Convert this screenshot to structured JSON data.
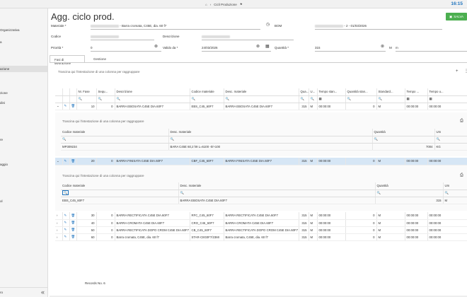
{
  "topbar": {
    "home_icon": "home-icon",
    "breadcrumb": "Cicli Produzione",
    "time": "16:15"
  },
  "sidebar": {
    "items": [
      "Organizzativa",
      "a",
      "azione",
      "zione",
      "dini",
      "re",
      "aggio",
      "ol"
    ],
    "footer_label": "ro",
    "collapse_glyph": "«"
  },
  "header": {
    "title": "Agg. ciclo prod.",
    "save_label": "SALVA"
  },
  "form": {
    "materiale_label": "Materiale *",
    "materiale_value": " - Barra cromata, C45E, dia. 60 f7",
    "bom_label": "BOM",
    "bom_value": " - 2 - 01/03/2026",
    "codice_label": "Codice",
    "descrizione_label": "Descrizione",
    "priorita_label": "Priorità *",
    "priorita_value": "0",
    "valido_label": "Valido da *",
    "valido_value": "24/03/2026",
    "quantita_label": "Quantità *",
    "quantita_value": "315",
    "um_label": "M",
    "um_value": "m"
  },
  "tabs": [
    "Fasi di lavorazione",
    "Gestione"
  ],
  "grid": {
    "group_hint": "Trascina qui l'intestazione di una colonna per raggruppare",
    "columns": [
      "Nr. Fase",
      "Sequ...",
      "Descrizione",
      "Codice materiale",
      "Desc. materiale",
      "Qua...",
      "U...",
      "Tempo stan...",
      "Quantità stan...",
      "Standard...",
      "Tempo ...",
      "Tempo u..."
    ],
    "rows": [
      {
        "fase": "10",
        "seq": "0",
        "desc": "BARRA EBOSATA C45E DIA.60F7",
        "code": "EBS_C45_60F7",
        "mat": "BARRA EBOSATA C45E DIA.60F7",
        "qty": "315",
        "um": "M",
        "t1": "00:00:00",
        "q2": "0",
        "um2": "M",
        "t2": "00:00:00",
        "t3": "00:00:00"
      },
      {
        "fase": "20",
        "seq": "0",
        "desc": "BARRA FINISATA C45E DIA.60F7",
        "code": "CBF_C45_60F7",
        "mat": "BARRA FINISATA C45E DIA.60F7",
        "qty": "315",
        "um": "M",
        "t1": "00:00:00",
        "q2": "0",
        "um2": "M",
        "t2": "00:00:00",
        "t3": "00:00:00"
      },
      {
        "fase": "30",
        "seq": "0",
        "desc": "BARRA RECTIFICATA C45E DIA.60F7",
        "code": "RFC_C45_60F7",
        "mat": "BARRA RECTIFICATA C45E DIA.60F7",
        "qty": "315",
        "um": "M",
        "t1": "00:00:00",
        "q2": "0",
        "um2": "M",
        "t2": "00:00:00",
        "t3": "00:00:00"
      },
      {
        "fase": "40",
        "seq": "0",
        "desc": "BARRA CROMATA C45E DIA.60F7",
        "code": "CRO_C45_60F7",
        "mat": "BARRA CROMATA C45E DIA.60F7",
        "qty": "315",
        "um": "M",
        "t1": "00:00:00",
        "q2": "0",
        "um2": "M",
        "t2": "00:00:00",
        "t3": "00:00:00"
      },
      {
        "fase": "50",
        "seq": "0",
        "desc": "BARRA RECTIFICATA DOPO CROM C45E DIA.60F7",
        "code": "CB_C45_60F7",
        "mat": "BARRA RECTIFICATA DOPO CROM C45E DIA.60F7",
        "qty": "315",
        "um": "M",
        "t1": "00:00:00",
        "q2": "0",
        "um2": "M",
        "t2": "00:00:00",
        "t3": "00:00:00"
      },
      {
        "fase": "60",
        "seq": "0",
        "desc": "Barra cromata, C45E, dia. 60 f7",
        "code": "STAR-C8G0F7/23MI",
        "mat": "Barra cromata, C45E, dia. 60 f7",
        "qty": "315",
        "um": "M",
        "t1": "00:00:00",
        "q2": "0",
        "um2": "M",
        "t2": "00:00:00",
        "t3": "00:00:00"
      }
    ],
    "footer": "Records No. 6"
  },
  "sub1": {
    "hint": "Trascina qui l'intestazione di una colonna per raggruppare",
    "columns": [
      "Codice materiale",
      "Desc. materiale",
      "Quantità",
      "Um"
    ],
    "rows": [
      {
        "code": "MP309234",
        "desc": "BARA C45E 60,2 h9 L=6100 -0/+100",
        "qty": "7004",
        "um": "KG"
      }
    ]
  },
  "sub2": {
    "hint": "Trascina qui l'intestazione di una colonna per raggruppare",
    "columns": [
      "Codice materiale",
      "Desc. materiale",
      "Quantità",
      "Um"
    ],
    "rows": [
      {
        "code": "EBS_C45_60F7",
        "desc": "BARRA EBOSATA C45E DIA.60F7",
        "qty": "315",
        "um": "M"
      }
    ]
  },
  "colors": {
    "accent": "#1e73be",
    "save": "#4caf50",
    "selected_row": "#d6e6f5"
  }
}
